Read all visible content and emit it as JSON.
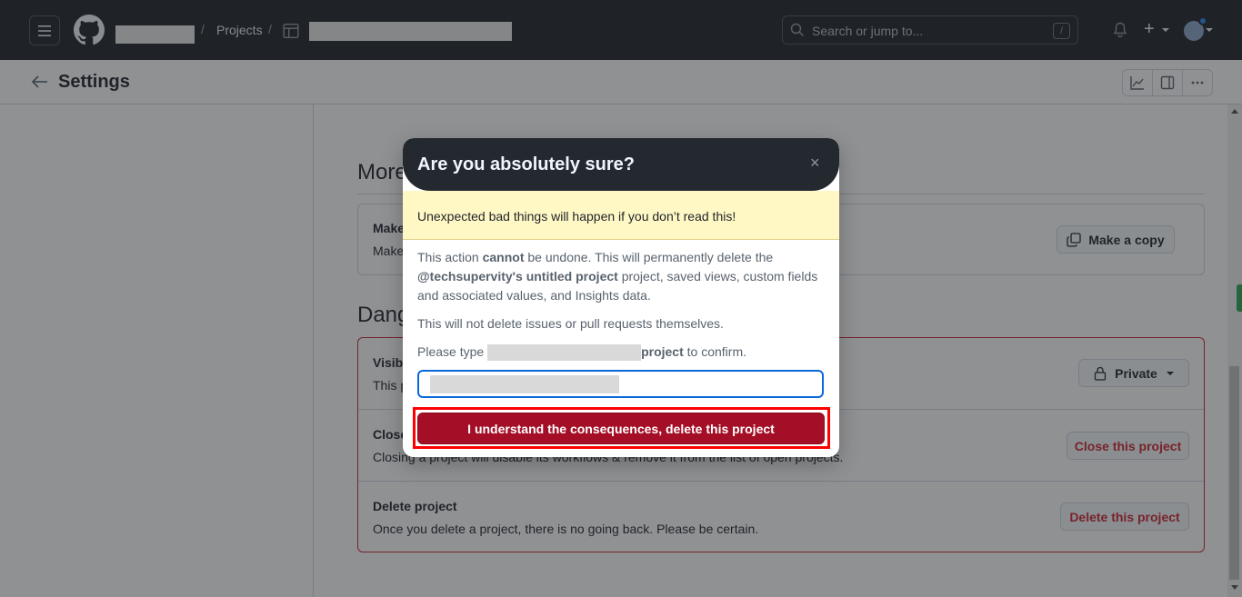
{
  "header": {
    "breadcrumb_projects": "Projects",
    "breadcrumb_sep": "/",
    "search_placeholder": "Search or jump to...",
    "search_shortcut": "/",
    "plus_symbol": "+"
  },
  "subheader": {
    "title": "Settings"
  },
  "page": {
    "more_title": "More options",
    "make_copy_title": "Make a copy",
    "make_copy_desc": "Make a copy of this project",
    "make_copy_button": "Make a copy",
    "danger_title": "Danger zone",
    "visibility_title": "Visibility",
    "visibility_desc": "This project is currently private.",
    "visibility_button": "Private",
    "close_title": "Close project",
    "close_desc": "Closing a project will disable its workflows & remove it from the list of open projects.",
    "close_button": "Close this project",
    "delete_title": "Delete project",
    "delete_desc": "Once you delete a project, there is no going back. Please be certain.",
    "delete_button": "Delete this project"
  },
  "modal": {
    "title": "Are you absolutely sure?",
    "close_symbol": "×",
    "warning": "Unexpected bad things will happen if you don’t read this!",
    "p1_a": "This action ",
    "p1_b": "cannot",
    "p1_c": " be undone. This will permanently delete the ",
    "p1_d": "@techsupervity's untitled project",
    "p1_e": " project, saved views, custom fields and associated values, and Insights data.",
    "p2": "This will not delete issues or pull requests themselves.",
    "p3_a": "Please type ",
    "p3_b": "project",
    "p3_c": " to confirm.",
    "confirm_button": "I understand the consequences, delete this project"
  },
  "colors": {
    "header_bg": "#1f2328",
    "danger_red": "#cf222e",
    "delete_button_bg": "#a40e26",
    "warning_bg": "#fff8c5",
    "focus_blue": "#0969da"
  }
}
